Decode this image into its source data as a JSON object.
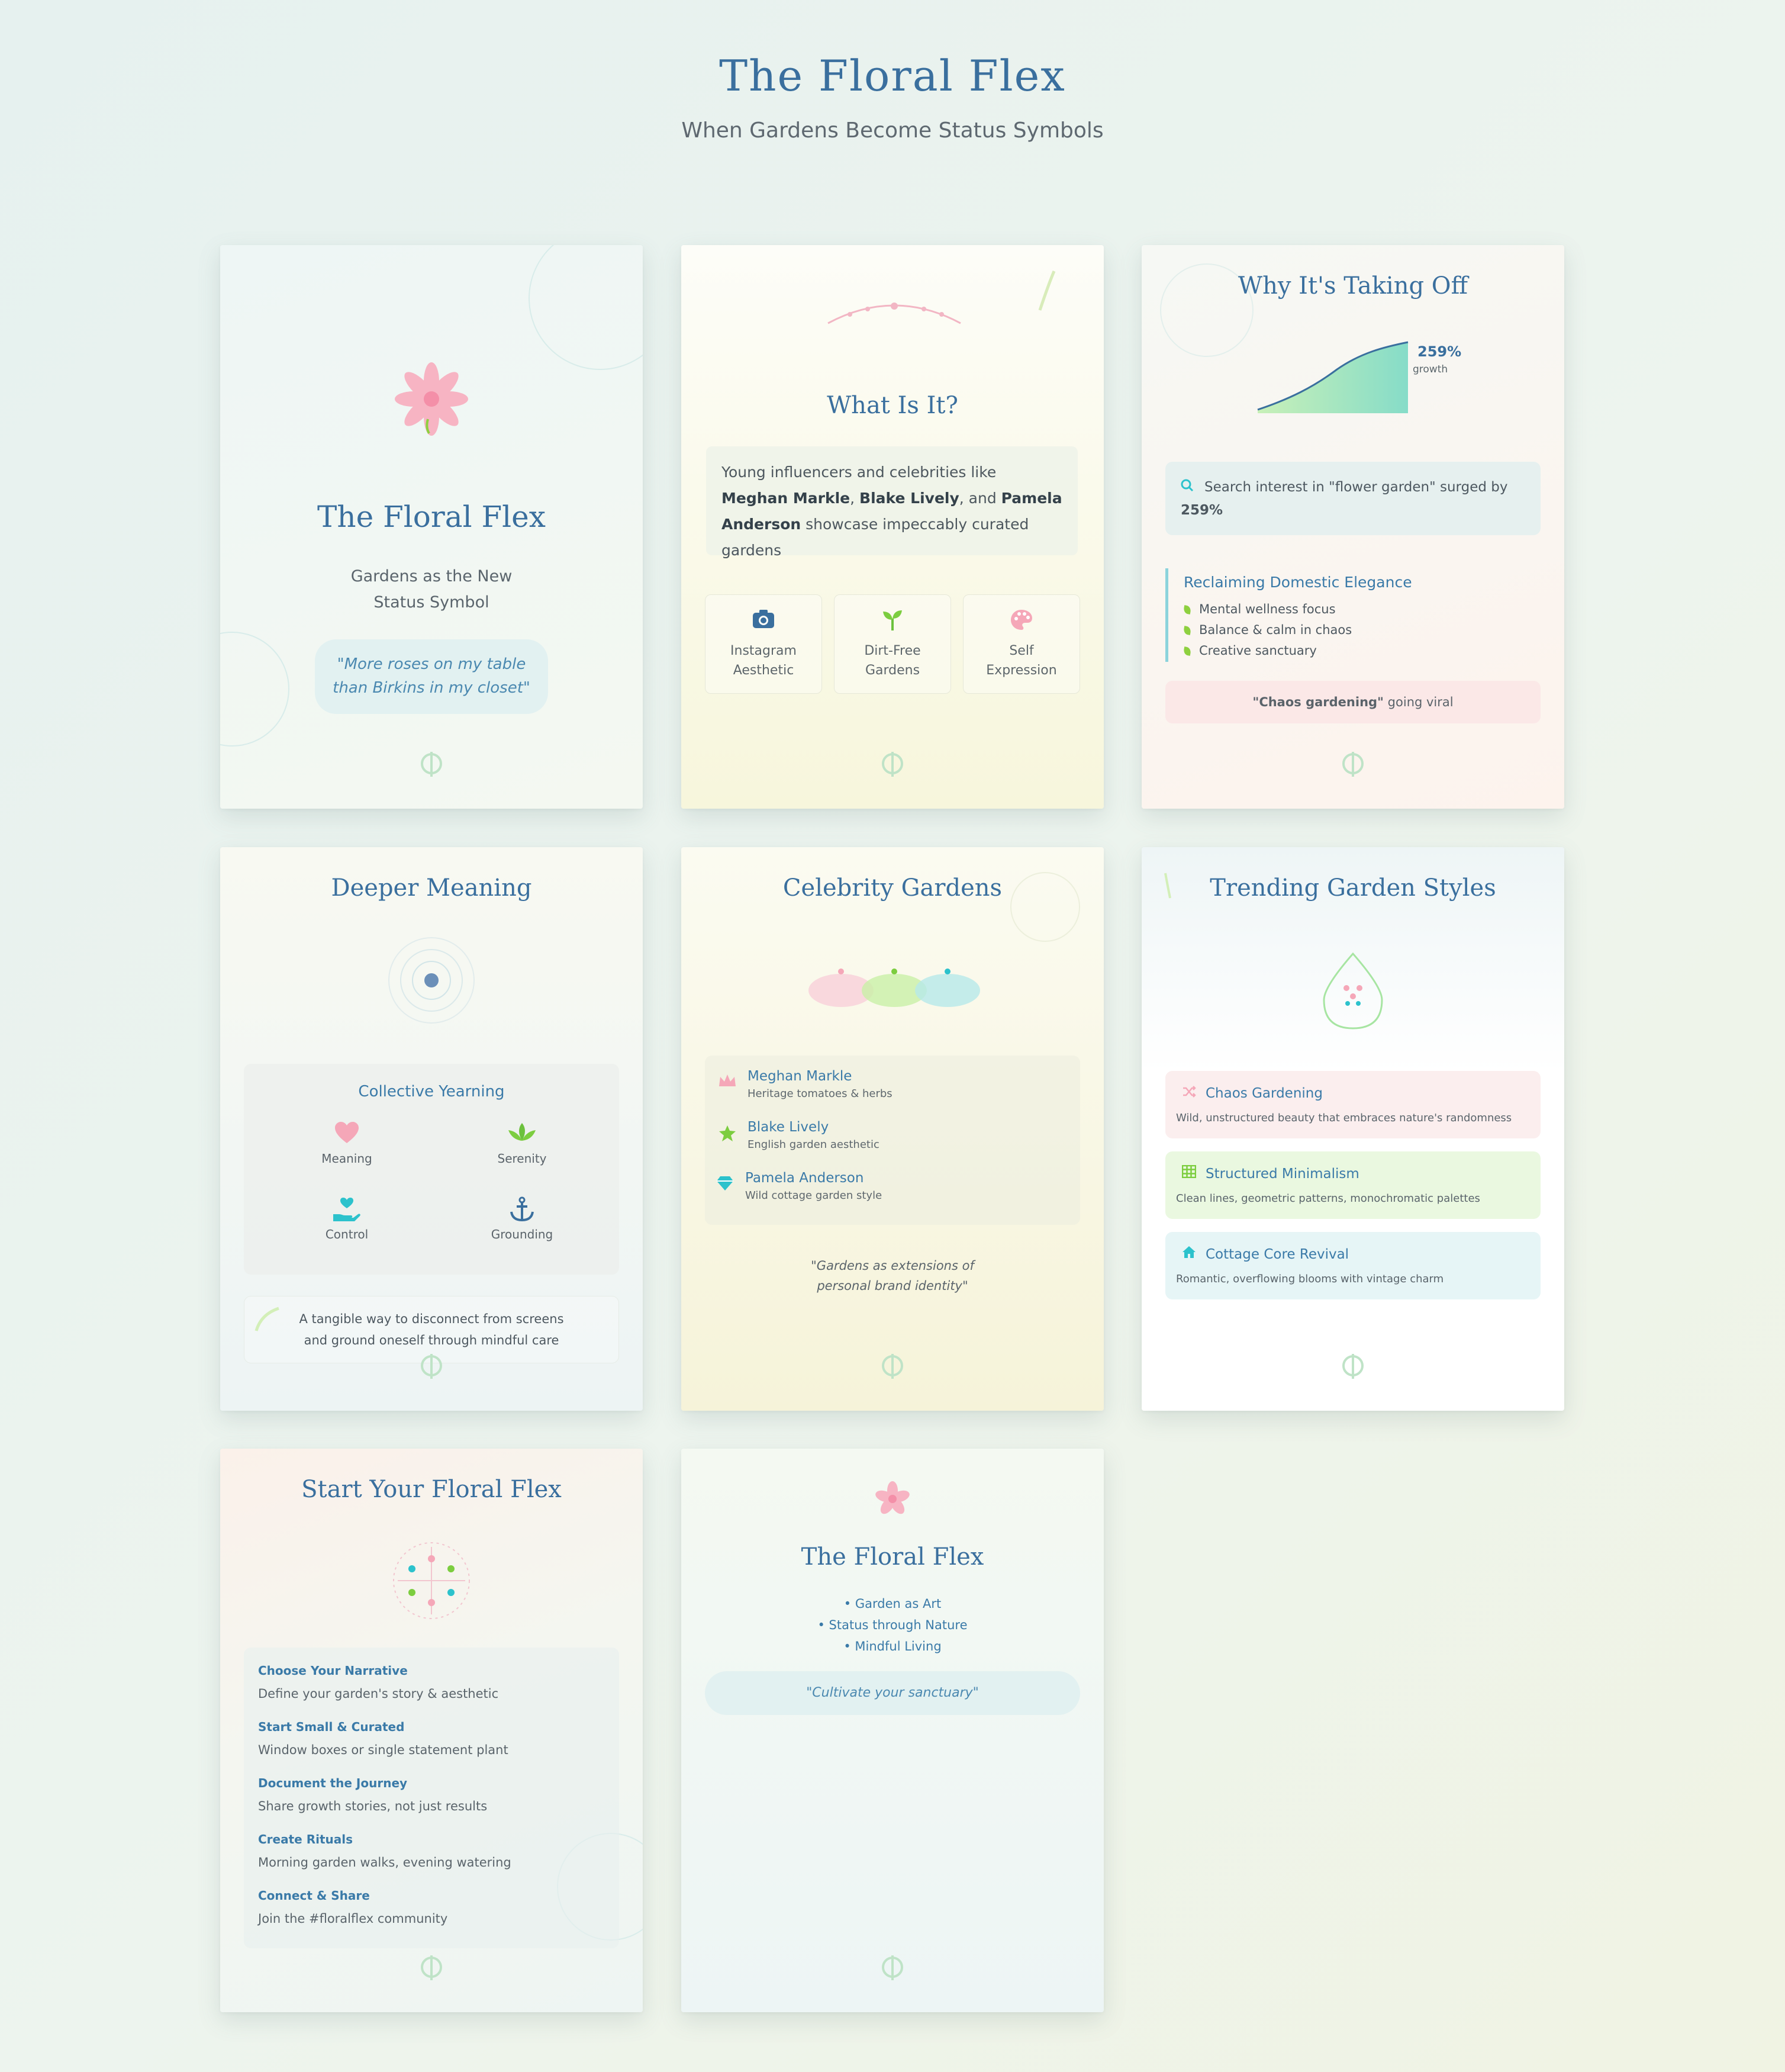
{
  "header": {
    "title": "The Floral Flex",
    "subtitle": "When Gardens Become Status Symbols"
  },
  "colors": {
    "accent_blue": "#3a6f9e",
    "pink": "#f5a7b8",
    "green": "#8ed03f",
    "teal": "#2cc2cc"
  },
  "cards": {
    "cover": {
      "title": "The Floral Flex",
      "subtitle_line1": "Gardens as the New",
      "subtitle_line2": "Status Symbol",
      "quote_line1": "\"More roses on my table",
      "quote_line2": "than Birkins in my closet\"",
      "icon": "flower-icon"
    },
    "what": {
      "title": "What Is It?",
      "intro_prefix": "Young influencers and celebrities like ",
      "name1": "Meghan Markle",
      "sep1": ", ",
      "name2": "Blake Lively",
      "sep2": ", and ",
      "name3": "Pamela Anderson",
      "intro_suffix": " showcase impeccably curated gardens",
      "features": [
        {
          "line1": "Instagram",
          "line2": "Aesthetic",
          "icon": "camera-icon"
        },
        {
          "line1": "Dirt-Free",
          "line2": "Gardens",
          "icon": "seedling-icon"
        },
        {
          "line1": "Self",
          "line2": "Expression",
          "icon": "palette-icon"
        }
      ]
    },
    "why": {
      "title": "Why It's Taking Off",
      "growth_value": "259%",
      "growth_label": "growth",
      "search_text": "Search interest in \"flower garden\" surged by",
      "search_value": "259%",
      "section_title": "Reclaiming Domestic Elegance",
      "bullets": [
        "Mental wellness focus",
        "Balance & calm in chaos",
        "Creative sanctuary"
      ],
      "chaos_bold": "\"Chaos gardening\"",
      "chaos_rest": " going viral"
    },
    "deeper": {
      "title": "Deeper Meaning",
      "box_title": "Collective Yearning",
      "items": [
        {
          "label": "Meaning",
          "icon": "heart-icon"
        },
        {
          "label": "Serenity",
          "icon": "lotus-icon"
        },
        {
          "label": "Control",
          "icon": "hand-holding-heart-icon"
        },
        {
          "label": "Grounding",
          "icon": "anchor-icon"
        }
      ],
      "note_line1": "A tangible way to disconnect from screens",
      "note_line2": "and ground oneself through mindful care"
    },
    "celebrity": {
      "title": "Celebrity Gardens",
      "people": [
        {
          "name": "Meghan Markle",
          "desc": "Heritage tomatoes & herbs",
          "icon": "crown-icon"
        },
        {
          "name": "Blake Lively",
          "desc": "English garden aesthetic",
          "icon": "star-icon"
        },
        {
          "name": "Pamela Anderson",
          "desc": "Wild cottage garden style",
          "icon": "gem-icon"
        }
      ],
      "quote_line1": "\"Gardens as extensions of",
      "quote_line2": "personal brand identity\""
    },
    "styles": {
      "title": "Trending Garden Styles",
      "items": [
        {
          "name": "Chaos Gardening",
          "desc": "Wild, unstructured beauty that embraces nature's randomness",
          "icon": "shuffle-icon"
        },
        {
          "name": "Structured Minimalism",
          "desc": "Clean lines, geometric patterns, monochromatic palettes",
          "icon": "grid-icon"
        },
        {
          "name": "Cottage Core Revival",
          "desc": "Romantic, overflowing blooms with vintage charm",
          "icon": "home-icon"
        }
      ]
    },
    "start": {
      "title": "Start Your Floral Flex",
      "steps": [
        {
          "name": "Choose Your Narrative",
          "desc": "Define your garden's story & aesthetic"
        },
        {
          "name": "Start Small & Curated",
          "desc": "Window boxes or single statement plant"
        },
        {
          "name": "Document the Journey",
          "desc": "Share growth stories, not just results"
        },
        {
          "name": "Create Rituals",
          "desc": "Morning garden walks, evening watering"
        },
        {
          "name": "Connect & Share",
          "desc": "Join the #floralflex community"
        }
      ]
    },
    "closing": {
      "title": "The Floral Flex",
      "points": [
        "• Garden as Art",
        "• Status through Nature",
        "• Mindful Living"
      ],
      "quote": "\"Cultivate your sanctuary\""
    }
  }
}
